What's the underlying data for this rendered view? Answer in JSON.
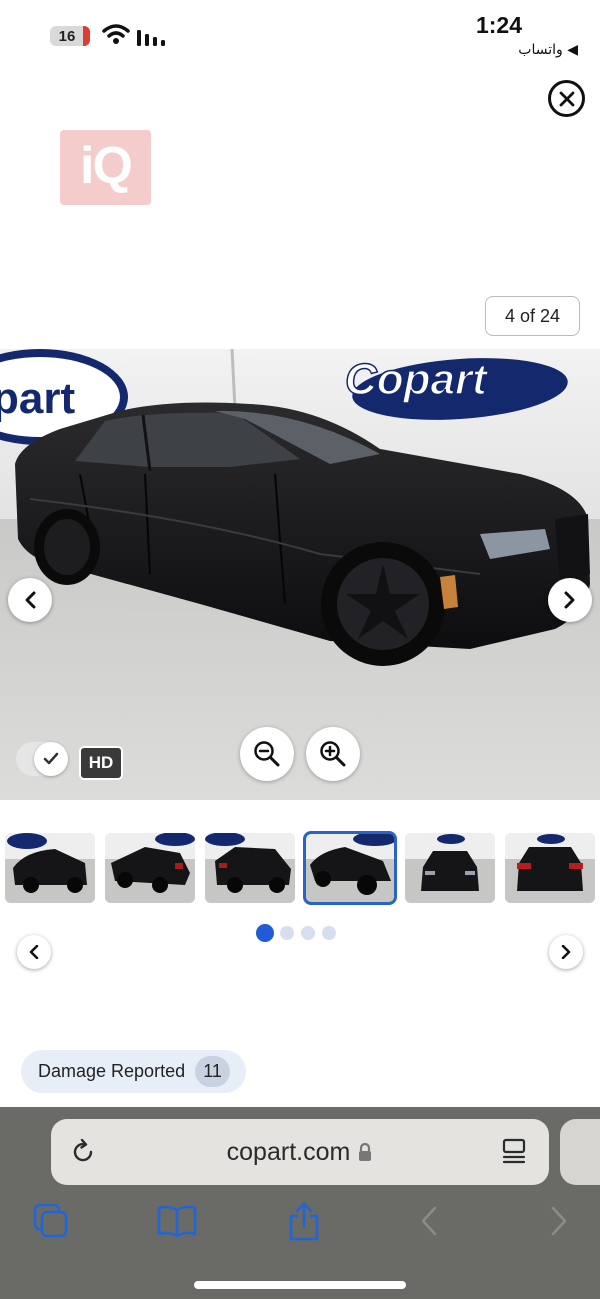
{
  "status_bar": {
    "battery_level": "16",
    "time": "1:24",
    "back_app": "◀ واتساب"
  },
  "logo": {
    "text": "iQ"
  },
  "viewer": {
    "counter": "4 of 24",
    "hd_label": "HD",
    "hd_toggle_on": true
  },
  "thumbnails": {
    "count": 6,
    "selected_index": 3,
    "page_dots": 4,
    "active_dot": 0
  },
  "damage": {
    "label": "Damage Reported",
    "count": "11"
  },
  "browser": {
    "url": "copart.com",
    "secure": true
  },
  "colors": {
    "accent": "#1f5cd6",
    "thumb_selected": "#2a63c8",
    "damage_pill": "#e8eef8",
    "browser_bar": "#6a6a67",
    "toolbar_icon": "#1f66d6"
  }
}
